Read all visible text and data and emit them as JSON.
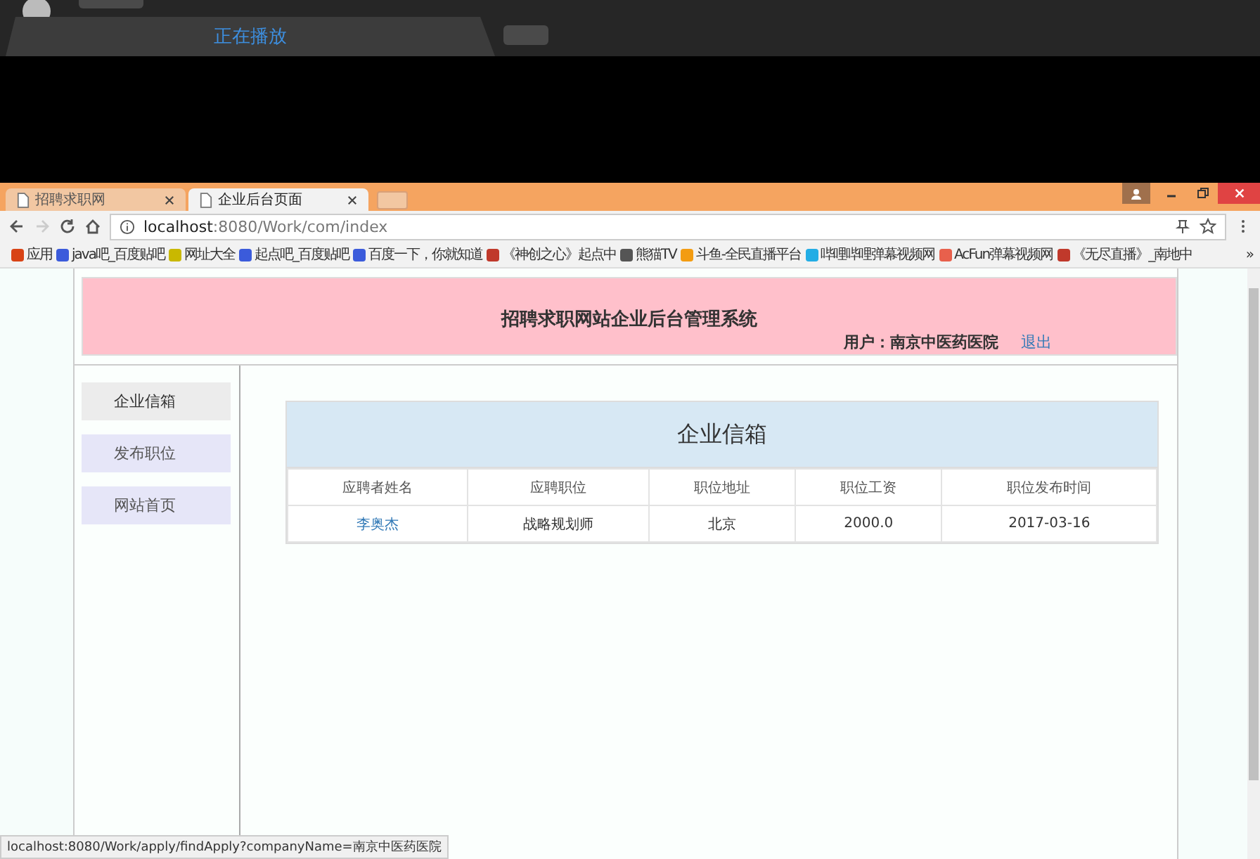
{
  "player": {
    "tab_label": "正在播放"
  },
  "browser": {
    "tabs": [
      {
        "label": "招聘求职网",
        "selected": false
      },
      {
        "label": "企业后台页面",
        "selected": true
      }
    ],
    "url_host": "localhost",
    "url_path": ":8080/Work/com/index",
    "bookmarks": [
      {
        "label": "应用",
        "kind": "apps"
      },
      {
        "label": "java吧_百度贴吧",
        "kind": "paw"
      },
      {
        "label": "网址大全",
        "kind": "globe"
      },
      {
        "label": "起点吧_百度贴吧",
        "kind": "paw"
      },
      {
        "label": "百度一下，你就知道",
        "kind": "paw"
      },
      {
        "label": "《神创之心》起点中",
        "kind": "book"
      },
      {
        "label": "熊猫TV",
        "kind": "panda"
      },
      {
        "label": "斗鱼-全民直播平台",
        "kind": "douyu"
      },
      {
        "label": "哔哩哔哩弹幕视频网",
        "kind": "tv"
      },
      {
        "label": "AcFun弹幕视频网",
        "kind": "acfun"
      },
      {
        "label": "《无尽直播》_南地中",
        "kind": "book"
      }
    ],
    "more": "»"
  },
  "page": {
    "title": "招聘求职网站企业后台管理系统",
    "user": "用户：南京中医药医院",
    "logout": "退出",
    "nav": [
      {
        "label": "企业信箱",
        "selected": true
      },
      {
        "label": "发布职位",
        "selected": false
      },
      {
        "label": "网站首页",
        "selected": false
      }
    ],
    "panel_title": "企业信箱",
    "table": {
      "columns": [
        "应聘者姓名",
        "应聘职位",
        "职位地址",
        "职位工资",
        "职位发布时间"
      ],
      "rows": [
        [
          "李奥杰",
          "战略规划师",
          "北京",
          "2000.0",
          "2017-03-16"
        ]
      ]
    }
  },
  "status_bar": "localhost:8080/Work/apply/findApply?companyName=南京中医药医院"
}
